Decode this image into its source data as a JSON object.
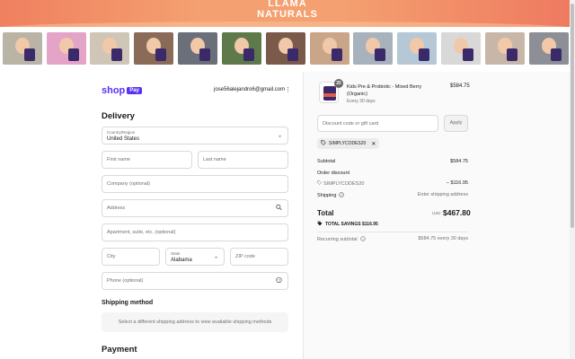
{
  "brand": {
    "line1": "LLAMA",
    "line2": "NATURALS"
  },
  "thumbnails": [
    {
      "bg": "#b9b4a5"
    },
    {
      "bg": "#e3a4c8"
    },
    {
      "bg": "#cfc6b7"
    },
    {
      "bg": "#8a6b57"
    },
    {
      "bg": "#6b6f7a"
    },
    {
      "bg": "#5f7a4a"
    },
    {
      "bg": "#7a5a4b"
    },
    {
      "bg": "#c9a68a"
    },
    {
      "bg": "#a7b2bd"
    },
    {
      "bg": "#b6c8d6"
    },
    {
      "bg": "#d8d8d8"
    },
    {
      "bg": "#c8b7a8"
    },
    {
      "bg": "#8c8f96"
    }
  ],
  "header": {
    "shop_label": "shop",
    "pay_label": "Pay",
    "email": "jose56alejandro6@gmail.com",
    "menu_glyph": "⋮"
  },
  "delivery": {
    "title": "Delivery",
    "country_label": "Country/Region",
    "country_value": "United States",
    "first_name_ph": "First name",
    "last_name_ph": "Last name",
    "company_ph": "Company (optional)",
    "address_ph": "Address",
    "apartment_ph": "Apartment, suite, etc. (optional)",
    "city_ph": "City",
    "state_label": "State",
    "state_value": "Alabama",
    "zip_ph": "ZIP code",
    "phone_ph": "Phone (optional)"
  },
  "shipping_method": {
    "title": "Shipping method",
    "message": "Select a different shipping address to view available shipping methods"
  },
  "payment": {
    "title": "Payment"
  },
  "summary": {
    "item": {
      "name": "Kids Pre & Probiotic - Mixed Berry (Organic)",
      "frequency": "Every 30 days",
      "price": "$584.75",
      "quantity": "25"
    },
    "discount_ph": "Discount code or gift card",
    "apply_label": "Apply",
    "applied_code": "SIMPLYCODES20",
    "subtotal_label": "Subtotal",
    "subtotal_value": "$584.75",
    "order_discount_label": "Order discount",
    "discount_code": "SIMPLYCODES20",
    "discount_value": "− $116.95",
    "shipping_label": "Shipping",
    "shipping_value": "Enter shipping address",
    "total_label": "Total",
    "currency": "USD",
    "total_value": "$467.80",
    "savings_text": "TOTAL SAVINGS $116.95",
    "recurring_label": "Recurring subtotal",
    "recurring_value": "$584.75 every 30 days"
  },
  "colors": {
    "shop_purple": "#5a31f4",
    "banner": "#f4a070"
  }
}
